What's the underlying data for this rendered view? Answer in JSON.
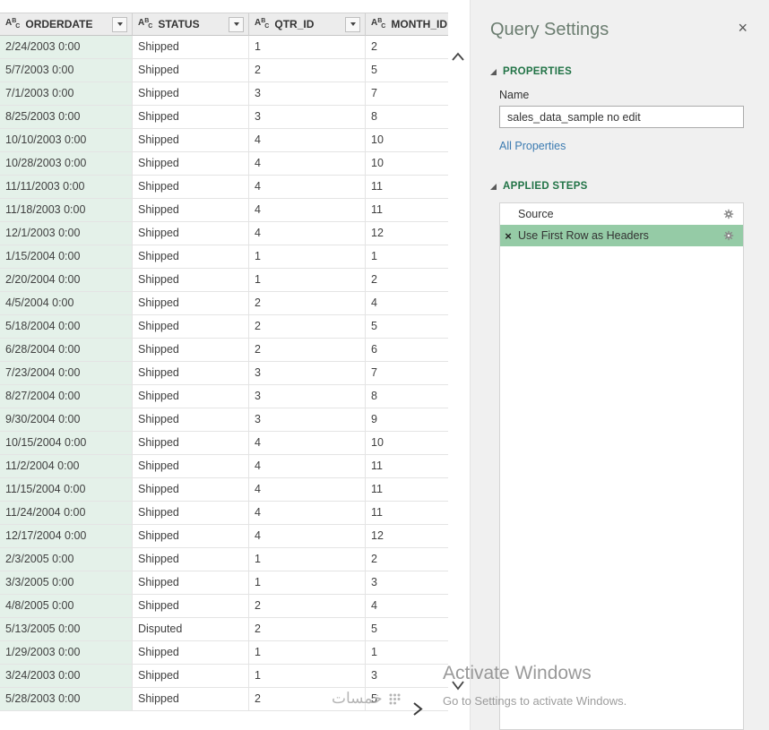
{
  "table": {
    "columns": [
      {
        "label": "ORDERDATE",
        "type_icon": "abc-text-type-icon"
      },
      {
        "label": "STATUS",
        "type_icon": "abc-text-type-icon"
      },
      {
        "label": "QTR_ID",
        "type_icon": "abc-text-type-icon"
      },
      {
        "label": "MONTH_ID",
        "type_icon": "abc-text-type-icon"
      }
    ],
    "rows": [
      [
        "2/24/2003 0:00",
        "Shipped",
        "1",
        "2"
      ],
      [
        "5/7/2003 0:00",
        "Shipped",
        "2",
        "5"
      ],
      [
        "7/1/2003 0:00",
        "Shipped",
        "3",
        "7"
      ],
      [
        "8/25/2003 0:00",
        "Shipped",
        "3",
        "8"
      ],
      [
        "10/10/2003 0:00",
        "Shipped",
        "4",
        "10"
      ],
      [
        "10/28/2003 0:00",
        "Shipped",
        "4",
        "10"
      ],
      [
        "11/11/2003 0:00",
        "Shipped",
        "4",
        "11"
      ],
      [
        "11/18/2003 0:00",
        "Shipped",
        "4",
        "11"
      ],
      [
        "12/1/2003 0:00",
        "Shipped",
        "4",
        "12"
      ],
      [
        "1/15/2004 0:00",
        "Shipped",
        "1",
        "1"
      ],
      [
        "2/20/2004 0:00",
        "Shipped",
        "1",
        "2"
      ],
      [
        "4/5/2004 0:00",
        "Shipped",
        "2",
        "4"
      ],
      [
        "5/18/2004 0:00",
        "Shipped",
        "2",
        "5"
      ],
      [
        "6/28/2004 0:00",
        "Shipped",
        "2",
        "6"
      ],
      [
        "7/23/2004 0:00",
        "Shipped",
        "3",
        "7"
      ],
      [
        "8/27/2004 0:00",
        "Shipped",
        "3",
        "8"
      ],
      [
        "9/30/2004 0:00",
        "Shipped",
        "3",
        "9"
      ],
      [
        "10/15/2004 0:00",
        "Shipped",
        "4",
        "10"
      ],
      [
        "11/2/2004 0:00",
        "Shipped",
        "4",
        "11"
      ],
      [
        "11/15/2004 0:00",
        "Shipped",
        "4",
        "11"
      ],
      [
        "11/24/2004 0:00",
        "Shipped",
        "4",
        "11"
      ],
      [
        "12/17/2004 0:00",
        "Shipped",
        "4",
        "12"
      ],
      [
        "2/3/2005 0:00",
        "Shipped",
        "1",
        "2"
      ],
      [
        "3/3/2005 0:00",
        "Shipped",
        "1",
        "3"
      ],
      [
        "4/8/2005 0:00",
        "Shipped",
        "2",
        "4"
      ],
      [
        "5/13/2005 0:00",
        "Disputed",
        "2",
        "5"
      ],
      [
        "1/29/2003 0:00",
        "Shipped",
        "1",
        "1"
      ],
      [
        "3/24/2003 0:00",
        "Shipped",
        "1",
        "3"
      ],
      [
        "5/28/2003 0:00",
        "Shipped",
        "2",
        "5"
      ]
    ]
  },
  "query_settings": {
    "title": "Query Settings",
    "properties": {
      "header": "PROPERTIES",
      "name_label": "Name",
      "name_value": "sales_data_sample no edit",
      "all_properties_link": "All Properties"
    },
    "applied_steps": {
      "header": "APPLIED STEPS",
      "steps": [
        {
          "label": "Source",
          "selected": false,
          "removable": false
        },
        {
          "label": "Use First Row as Headers",
          "selected": true,
          "removable": true
        }
      ]
    }
  },
  "watermark": {
    "activate_line1": "Activate Windows",
    "activate_line2": "Go to Settings to activate Windows.",
    "khamsat": "خمسات"
  },
  "icons": {
    "close": "×",
    "delete_step": "×",
    "filter_dropdown": "▼",
    "type_icon_letters": "ABC",
    "gear": "gear-icon",
    "scroll_up": "chevron-up-icon",
    "scroll_down": "chevron-down-icon",
    "scroll_right": "chevron-right-icon"
  },
  "colors": {
    "accent_green": "#217346",
    "selected_step_bg": "#95cba6",
    "selected_column_bg": "#e4f1e9",
    "link_blue": "#3c7bb1",
    "panel_bg": "#f0f0f0"
  }
}
